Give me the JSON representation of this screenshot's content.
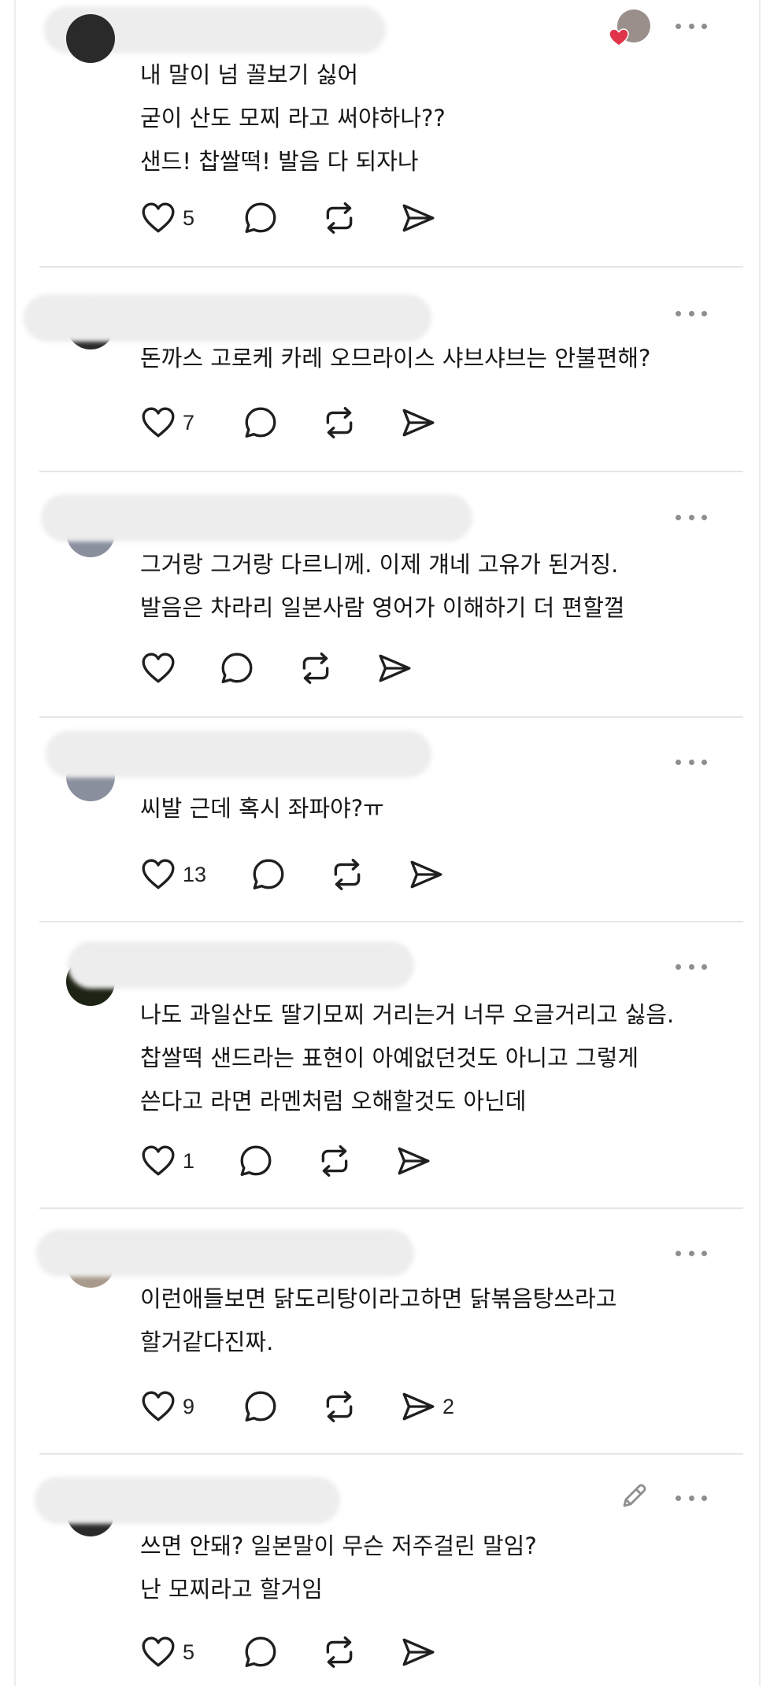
{
  "colors": {
    "like_badge": "#e0344a",
    "icon": "#1f1f1f",
    "divider": "#e6e6e6"
  },
  "icons": {
    "like": "heart-outline",
    "reply": "speech-bubble",
    "repost": "repost-arrows",
    "share": "paper-plane",
    "more": "ellipsis",
    "edit": "pencil"
  },
  "posts": [
    {
      "text": "내 말이 넘 꼴보기 싫어\n굳이 산도 모찌 라고 써야하나??\n샌드! 찹쌀떡! 발음 다 되자나",
      "likes": "5",
      "shares": ""
    },
    {
      "text": "돈까스 고로케 카레 오므라이스 샤브샤브는 안불편해?",
      "likes": "7",
      "shares": ""
    },
    {
      "text": "그거랑 그거랑 다르니께. 이제 걔네 고유가 된거징.\n발음은 차라리 일본사람 영어가 이해하기 더 편할껄",
      "likes": "",
      "shares": ""
    },
    {
      "text": "씨발 근데 혹시 좌파야?ㅠ",
      "likes": "13",
      "shares": ""
    },
    {
      "text": "나도 과일산도 딸기모찌 거리는거 너무 오글거리고 싫음.\n찹쌀떡 샌드라는 표현이 아예없던것도 아니고 그렇게\n쓴다고 라면 라멘처럼 오해할것도 아닌데",
      "likes": "1",
      "shares": ""
    },
    {
      "text": "이런애들보면 닭도리탕이라고하면 닭볶음탕쓰라고\n할거같다진짜.",
      "likes": "9",
      "shares": "2"
    },
    {
      "text": "쓰면 안돼? 일본말이 무슨 저주걸린 말임?\n난 모찌라고 할거임",
      "likes": "5",
      "shares": ""
    }
  ]
}
